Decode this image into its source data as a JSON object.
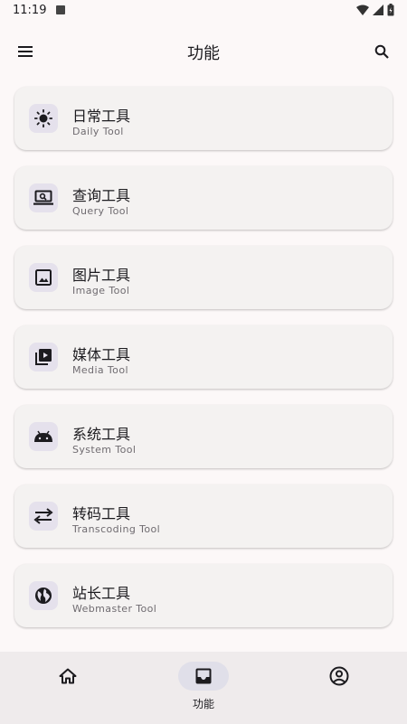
{
  "status_bar": {
    "time": "11:19"
  },
  "app_bar": {
    "title": "功能",
    "menu_icon": "menu-icon",
    "search_icon": "search-icon"
  },
  "tools": [
    {
      "title": "日常工具",
      "subtitle": "Daily Tool",
      "icon": "sun-icon"
    },
    {
      "title": "查询工具",
      "subtitle": "Query Tool",
      "icon": "laptop-search-icon"
    },
    {
      "title": "图片工具",
      "subtitle": "Image Tool",
      "icon": "image-icon"
    },
    {
      "title": "媒体工具",
      "subtitle": "Media Tool",
      "icon": "video-library-icon"
    },
    {
      "title": "系统工具",
      "subtitle": "System Tool",
      "icon": "android-icon"
    },
    {
      "title": "转码工具",
      "subtitle": "Transcoding Tool",
      "icon": "swap-arrows-icon"
    },
    {
      "title": "站长工具",
      "subtitle": "Webmaster Tool",
      "icon": "globe-icon"
    }
  ],
  "bottom_nav": {
    "items": [
      {
        "label": "",
        "icon": "home-icon",
        "active": false
      },
      {
        "label": "功能",
        "icon": "inbox-icon",
        "active": true
      },
      {
        "label": "",
        "icon": "account-circle-icon",
        "active": false
      }
    ]
  },
  "colors": {
    "background": "#fcf8f8",
    "card": "#f4f2f1",
    "icon_bg": "#e5e1ec",
    "nav_bg": "#efebec",
    "nav_active": "#e0dfe9"
  }
}
